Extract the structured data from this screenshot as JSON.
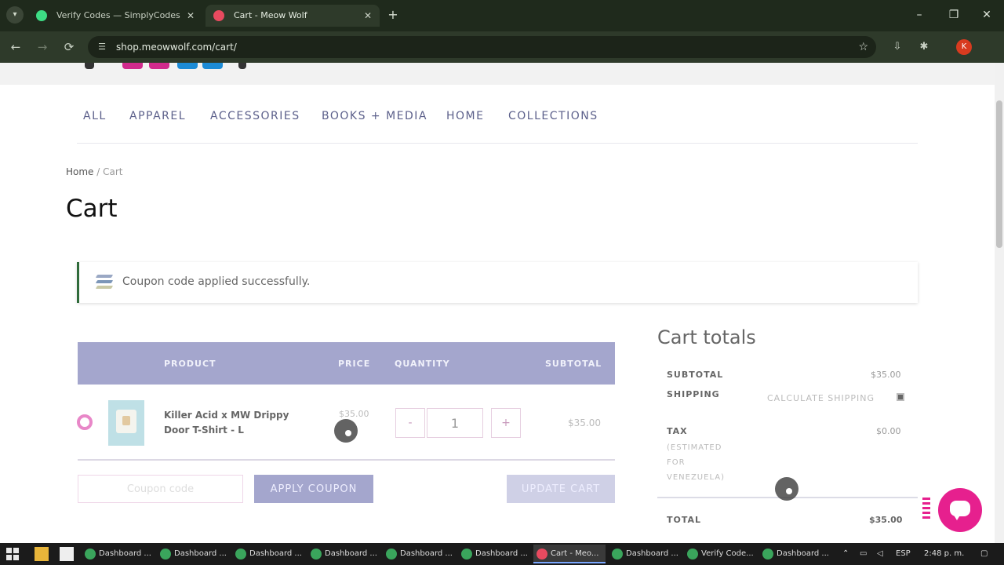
{
  "browser": {
    "tabs": [
      {
        "title": "Verify Codes — SimplyCodes",
        "favicon_color": "#3ddc84"
      },
      {
        "title": "Cart - Meow Wolf",
        "favicon_color": "#e84a5f"
      }
    ],
    "new_tab": "+",
    "url": "shop.meowwolf.com/cart/",
    "profile_initial": "K",
    "window_controls": {
      "minimize": "–",
      "maximize": "❐",
      "close": "✕"
    }
  },
  "nav": {
    "items": [
      "ALL",
      "APPAREL",
      "ACCESSORIES",
      "BOOKS + MEDIA",
      "HOME",
      "COLLECTIONS"
    ]
  },
  "breadcrumb": {
    "home": "Home",
    "separator": "/",
    "current": "Cart"
  },
  "page_title": "Cart",
  "notice": {
    "message": "Coupon code applied successfully."
  },
  "cart_table": {
    "headers": {
      "product": "PRODUCT",
      "price": "PRICE",
      "quantity": "QUANTITY",
      "subtotal": "SUBTOTAL"
    },
    "items": [
      {
        "name": "Killer Acid x MW Drippy Door T-Shirt - L",
        "price": "$35.00",
        "quantity": "1",
        "subtotal": "$35.00"
      }
    ],
    "qty_minus": "-",
    "qty_plus": "+"
  },
  "coupon": {
    "placeholder": "Coupon code",
    "apply_label": "APPLY COUPON"
  },
  "update_cart_label": "UPDATE CART",
  "totals": {
    "title": "Cart totals",
    "subtotal_label": "SUBTOTAL",
    "subtotal_value": "$35.00",
    "shipping_label": "SHIPPING",
    "shipping_value": "CALCULATE SHIPPING",
    "tax_label": "TAX",
    "tax_note": "(ESTIMATED FOR VENEZUELA)",
    "tax_value": "$0.00",
    "total_label": "TOTAL",
    "total_value": "$35.00"
  },
  "taskbar": {
    "items": [
      "Dashboard ...",
      "Dashboard ...",
      "Dashboard ...",
      "Dashboard ...",
      "Dashboard ...",
      "Dashboard ...",
      "Cart - Meo...",
      "Dashboard ...",
      "Verify Code...",
      "Dashboard ..."
    ],
    "active_index": 6,
    "language": "ESP",
    "time": "2:48 p. m."
  },
  "colors": {
    "accent_lavender": "#a4a6cd",
    "nav_text": "#5b5f8a",
    "chat_pink": "#e6208e",
    "notice_border": "#2f6b3a"
  }
}
